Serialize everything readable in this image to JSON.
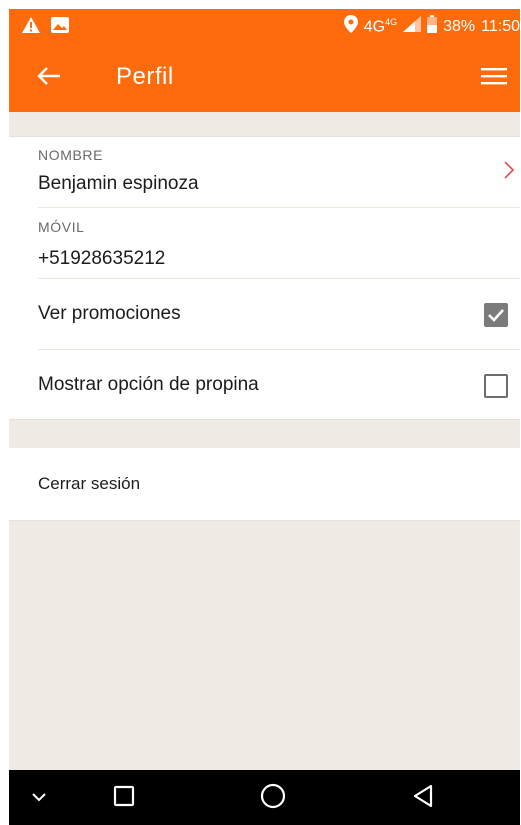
{
  "status_bar": {
    "network": "4G",
    "network_sup": "4G",
    "battery": "38%",
    "time": "11:50",
    "icons": [
      "warning-icon",
      "image-icon",
      "location-icon",
      "signal-icon",
      "battery-icon"
    ]
  },
  "app_bar": {
    "title": "Perfil",
    "back_icon": "arrow-left-icon",
    "menu_icon": "hamburger-menu-icon",
    "color": "#fe6b0c"
  },
  "profile": {
    "name_label": "NOMBRE",
    "name_value": "Benjamin espinoza",
    "phone_label": "MÓVIL",
    "phone_value": "+51928635212"
  },
  "options": [
    {
      "label": "Ver promociones",
      "checked": true
    },
    {
      "label": "Mostrar opción de propina",
      "checked": false
    }
  ],
  "logout_label": "Cerrar sesión",
  "nav_bar": {
    "buttons": [
      "chevron-down-icon",
      "square-icon",
      "circle-icon",
      "triangle-back-icon"
    ]
  },
  "colors": {
    "accent": "#fe6b0c",
    "chevron": "#e8494a",
    "background": "#efebe4"
  }
}
